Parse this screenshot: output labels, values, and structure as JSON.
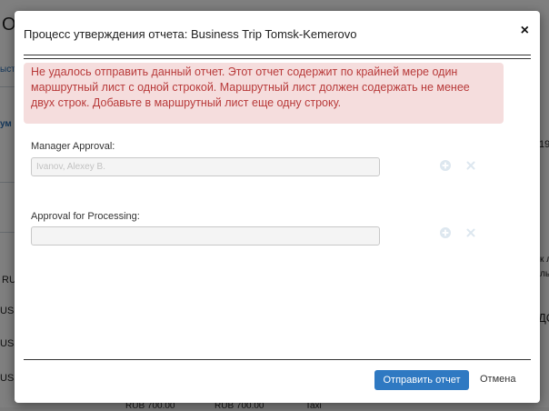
{
  "background": {
    "fragments": [
      "О",
      "ыст",
      "ум",
      "RU",
      "USS",
      "USS",
      "USS",
      "19",
      "к л",
      "ль",
      "ДО",
      "RUB 700.00",
      "RUB 700.00",
      "Taxi"
    ]
  },
  "modal": {
    "title": "Процесс утверждения отчета: Business Trip Tomsk-Kemerovo",
    "close_glyph": "×",
    "error_message": "Не удалось отправить данный отчет. Этот отчет содержит по крайней мере один маршрутный лист с одной строкой. Маршрутный лист должен содержать не менее двух строк. Добавьте в маршрутный лист еще одну строку.",
    "manager_approval": {
      "label": "Manager Approval:",
      "value": "Ivanov, Alexey B."
    },
    "approval_processing": {
      "label": "Approval for Processing:",
      "value": ""
    },
    "submit_label": "Отправить отчет",
    "cancel_label": "Отмена"
  },
  "colors": {
    "accent": "#2f79c2",
    "error_text": "#b83a3a",
    "error_bg": "#f5dddd"
  }
}
